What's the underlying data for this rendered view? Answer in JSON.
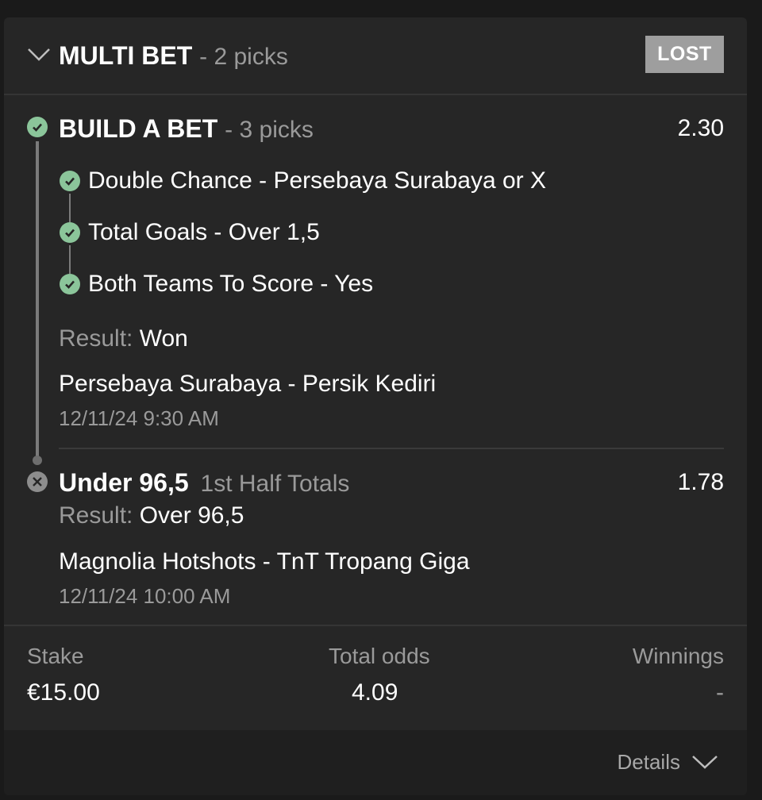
{
  "bet": {
    "type_label": "MULTI BET",
    "picks_label": "- 2 picks",
    "status": "LOST"
  },
  "build_a_bet": {
    "title": "BUILD A BET",
    "picks_label": "- 3 picks",
    "odds": "2.30",
    "selections": [
      {
        "text": "Double Chance - Persebaya Surabaya or X",
        "status_icon": "check-circle-icon"
      },
      {
        "text": "Total Goals - Over 1,5",
        "status_icon": "check-circle-icon"
      },
      {
        "text": "Both Teams To Score - Yes",
        "status_icon": "check-circle-icon"
      }
    ],
    "result_label": "Result:",
    "result_value": "Won",
    "match": "Persebaya Surabaya - Persik Kediri",
    "datetime": "12/11/24 9:30 AM"
  },
  "pick2": {
    "selection": "Under 96,5",
    "market": "1st Half Totals",
    "odds": "1.78",
    "result_label": "Result:",
    "result_value": "Over 96,5",
    "match": "Magnolia Hotshots - TnT Tropang Giga",
    "datetime": "12/11/24 10:00 AM"
  },
  "summary": {
    "stake_label": "Stake",
    "stake_value": "€15.00",
    "total_odds_label": "Total odds",
    "total_odds_value": "4.09",
    "winnings_label": "Winnings",
    "winnings_value": "-"
  },
  "footer": {
    "details_label": "Details"
  },
  "colors": {
    "background": "#1a1a1a",
    "card": "#262626",
    "won_green": "#8bc59a",
    "lost_grey": "#9e9e9e",
    "muted_text": "#9a9a9a"
  }
}
